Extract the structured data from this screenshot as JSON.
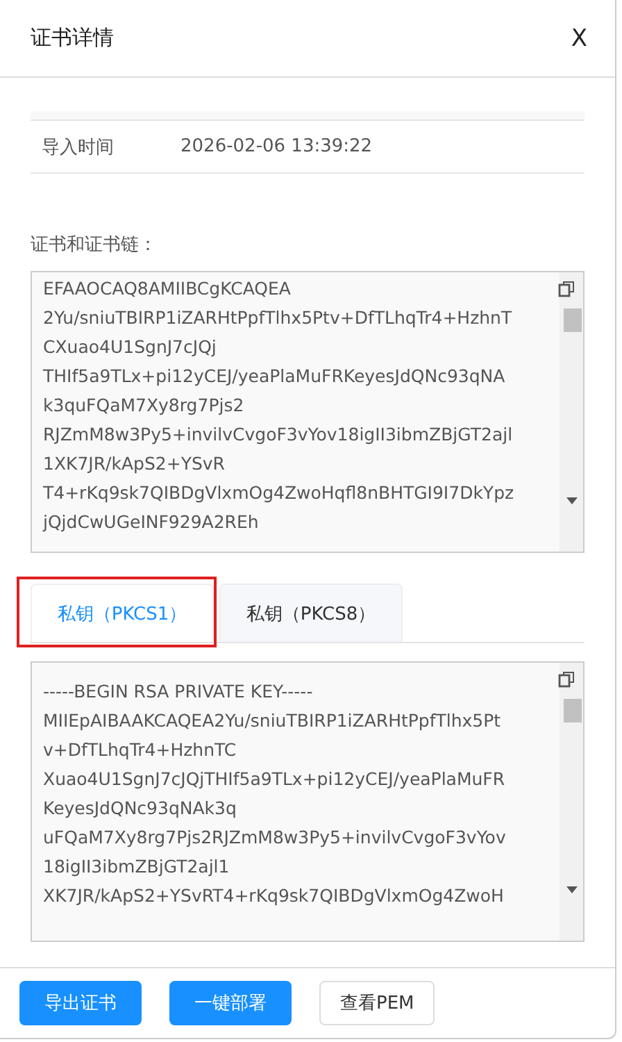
{
  "dialog": {
    "title": "证书详情",
    "close": "X"
  },
  "info_rows": [
    {
      "label": "导入时间",
      "value": "2026-02-06 13:39:22"
    }
  ],
  "certificate": {
    "label": "证书和证书链：",
    "lines": [
      "EFAAOCAQ8AMIIBCgKCAQEA",
      "2Yu/sniuTBIRP1iZARHtPpfTlhx5Ptv+DfTLhqTr4+HzhnT",
      "CXuao4U1SgnJ7cJQj",
      "THIf5a9TLx+pi12yCEJ/yeaPlaMuFRKeyesJdQNc93qNA",
      "k3quFQaM7Xy8rg7Pjs2",
      "RJZmM8w3Py5+invilvCvgoF3vYov18igII3ibmZBjGT2ajl",
      "1XK7JR/kApS2+YSvR",
      "T4+rKq9sk7QIBDgVlxmOg4ZwoHqfl8nBHTGI9I7DkYpz",
      "jQjdCwUGeINF929A2REh"
    ]
  },
  "tabs": [
    {
      "label": "私钥（PKCS1）",
      "selected": true
    },
    {
      "label": "私钥（PKCS8）",
      "selected": false
    }
  ],
  "private_key": {
    "lines": [
      "-----BEGIN RSA PRIVATE KEY-----",
      "MIIEpAIBAAKCAQEA2Yu/sniuTBIRP1iZARHtPpfTlhx5Pt",
      "v+DfTLhqTr4+HzhnTC",
      "Xuao4U1SgnJ7cJQjTHIf5a9TLx+pi12yCEJ/yeaPlaMuFR",
      "KeyesJdQNc93qNAk3q",
      "uFQaM7Xy8rg7Pjs2RJZmM8w3Py5+invilvCvgoF3vYov",
      "18igII3ibmZBjGT2ajl1",
      "XK7JR/kApS2+YSvRT4+rKq9sk7QIBDgVlxmOg4ZwoH"
    ]
  },
  "buttons": [
    {
      "label": "导出证书",
      "kind": "primary"
    },
    {
      "label": "一键部署",
      "kind": "primary"
    },
    {
      "label": "查看PEM",
      "kind": "default"
    }
  ]
}
